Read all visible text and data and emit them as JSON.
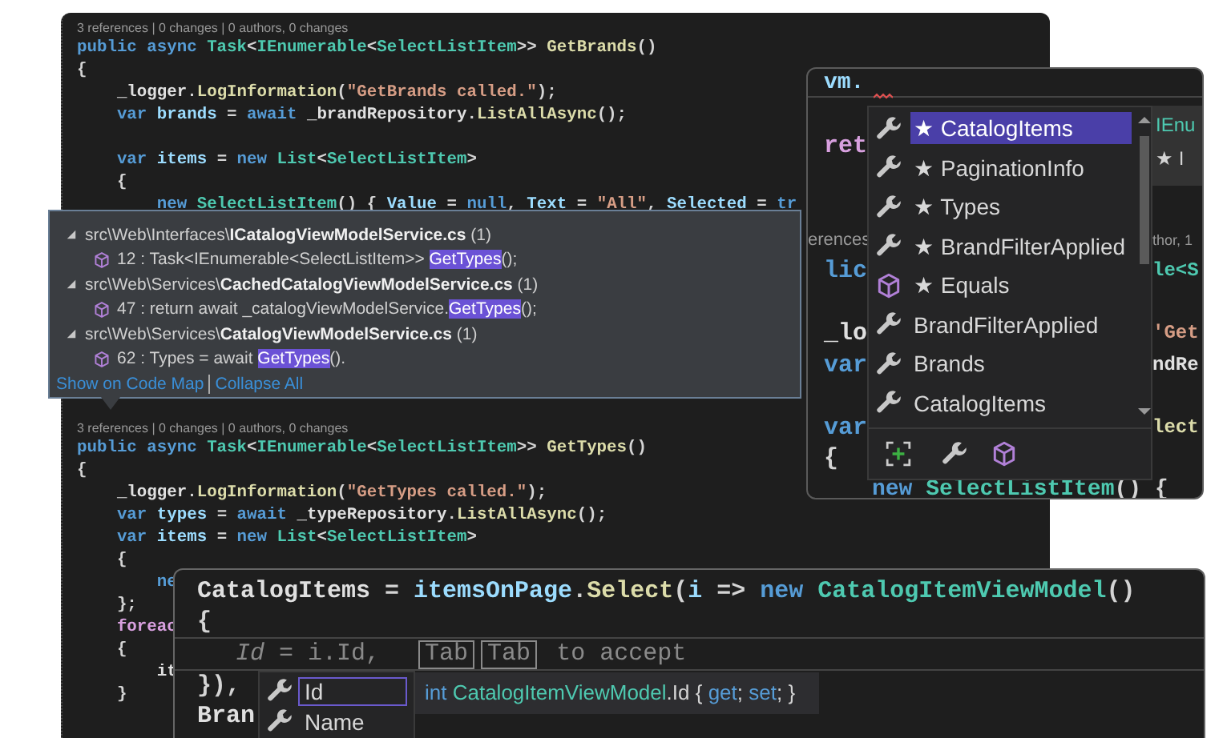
{
  "editor": {
    "lines_top": [
      {
        "kind": "lens",
        "text": "3 references | 0 changes | 0 authors, 0 changes"
      },
      {
        "kind": "code",
        "tokens": [
          {
            "text": "public async ",
            "kind": "kw"
          },
          {
            "text": "Task",
            "kind": "type"
          },
          {
            "text": "<",
            "kind": "plain"
          },
          {
            "text": "IEnumerable",
            "kind": "type"
          },
          {
            "text": "<",
            "kind": "plain"
          },
          {
            "text": "SelectListItem",
            "kind": "type"
          },
          {
            "text": ">> ",
            "kind": "plain"
          },
          {
            "text": "GetBrands",
            "kind": "method"
          },
          {
            "text": "()",
            "kind": "plain"
          }
        ]
      },
      {
        "kind": "code",
        "tokens": [
          {
            "text": "{",
            "kind": "plain"
          }
        ]
      },
      {
        "kind": "code",
        "tokens": [
          {
            "text": "    _logger",
            "kind": "field"
          },
          {
            "text": ".",
            "kind": "plain"
          },
          {
            "text": "LogInformation",
            "kind": "method"
          },
          {
            "text": "(",
            "kind": "plain"
          },
          {
            "text": "\"GetBrands called.\"",
            "kind": "str"
          },
          {
            "text": ");",
            "kind": "plain"
          }
        ]
      },
      {
        "kind": "code",
        "tokens": [
          {
            "text": "    var",
            "kind": "kw"
          },
          {
            "text": " brands",
            "kind": "var"
          },
          {
            "text": " = ",
            "kind": "plain"
          },
          {
            "text": "await",
            "kind": "kw"
          },
          {
            "text": " _brandRepository",
            "kind": "field"
          },
          {
            "text": ".",
            "kind": "plain"
          },
          {
            "text": "ListAllAsync",
            "kind": "method"
          },
          {
            "text": "();",
            "kind": "plain"
          }
        ]
      },
      {
        "kind": "blank"
      },
      {
        "kind": "code",
        "tokens": [
          {
            "text": "    var",
            "kind": "kw"
          },
          {
            "text": " items",
            "kind": "var"
          },
          {
            "text": " = ",
            "kind": "plain"
          },
          {
            "text": "new ",
            "kind": "kw"
          },
          {
            "text": "List",
            "kind": "type"
          },
          {
            "text": "<",
            "kind": "plain"
          },
          {
            "text": "SelectListItem",
            "kind": "type"
          },
          {
            "text": ">",
            "kind": "plain"
          }
        ]
      },
      {
        "kind": "code",
        "tokens": [
          {
            "text": "    {",
            "kind": "plain"
          }
        ]
      },
      {
        "kind": "code",
        "tokens": [
          {
            "text": "        new ",
            "kind": "kw"
          },
          {
            "text": "SelectListItem",
            "kind": "type"
          },
          {
            "text": "() { ",
            "kind": "plain"
          },
          {
            "text": "Value",
            "kind": "var"
          },
          {
            "text": " = ",
            "kind": "plain"
          },
          {
            "text": "null",
            "kind": "kw"
          },
          {
            "text": ", ",
            "kind": "plain"
          },
          {
            "text": "Text",
            "kind": "var"
          },
          {
            "text": " = ",
            "kind": "plain"
          },
          {
            "text": "\"All\"",
            "kind": "str"
          },
          {
            "text": ", ",
            "kind": "plain"
          },
          {
            "text": "Selected",
            "kind": "var"
          },
          {
            "text": " = ",
            "kind": "plain"
          },
          {
            "text": "tr",
            "kind": "kw"
          }
        ]
      }
    ],
    "lines_bottom": [
      {
        "kind": "lens",
        "text": "3 references | 0 changes | 0 authors, 0 changes"
      },
      {
        "kind": "code",
        "tokens": [
          {
            "text": "public async ",
            "kind": "kw"
          },
          {
            "text": "Task",
            "kind": "type"
          },
          {
            "text": "<",
            "kind": "plain"
          },
          {
            "text": "IEnumerable",
            "kind": "type"
          },
          {
            "text": "<",
            "kind": "plain"
          },
          {
            "text": "SelectListItem",
            "kind": "type"
          },
          {
            "text": ">> ",
            "kind": "plain"
          },
          {
            "text": "GetTypes",
            "kind": "method"
          },
          {
            "text": "()",
            "kind": "plain"
          }
        ]
      },
      {
        "kind": "code",
        "tokens": [
          {
            "text": "{",
            "kind": "plain"
          }
        ]
      },
      {
        "kind": "code",
        "tokens": [
          {
            "text": "    _logger",
            "kind": "field"
          },
          {
            "text": ".",
            "kind": "plain"
          },
          {
            "text": "LogInformation",
            "kind": "method"
          },
          {
            "text": "(",
            "kind": "plain"
          },
          {
            "text": "\"GetTypes called.\"",
            "kind": "str"
          },
          {
            "text": ");",
            "kind": "plain"
          }
        ]
      },
      {
        "kind": "code",
        "tokens": [
          {
            "text": "    var",
            "kind": "kw"
          },
          {
            "text": " types",
            "kind": "var"
          },
          {
            "text": " = ",
            "kind": "plain"
          },
          {
            "text": "await",
            "kind": "kw"
          },
          {
            "text": " _typeRepository",
            "kind": "field"
          },
          {
            "text": ".",
            "kind": "plain"
          },
          {
            "text": "ListAllAsync",
            "kind": "method"
          },
          {
            "text": "();",
            "kind": "plain"
          }
        ]
      },
      {
        "kind": "code",
        "tokens": [
          {
            "text": "    var",
            "kind": "kw"
          },
          {
            "text": " items",
            "kind": "var"
          },
          {
            "text": " = ",
            "kind": "plain"
          },
          {
            "text": "new ",
            "kind": "kw"
          },
          {
            "text": "List",
            "kind": "type"
          },
          {
            "text": "<",
            "kind": "plain"
          },
          {
            "text": "SelectListItem",
            "kind": "type"
          },
          {
            "text": ">",
            "kind": "plain"
          }
        ]
      },
      {
        "kind": "code",
        "tokens": [
          {
            "text": "    {",
            "kind": "plain"
          }
        ]
      },
      {
        "kind": "code",
        "tokens": [
          {
            "text": "        ne",
            "kind": "kw"
          }
        ]
      },
      {
        "kind": "code",
        "tokens": [
          {
            "text": "    };",
            "kind": "plain"
          }
        ]
      },
      {
        "kind": "code",
        "tokens": [
          {
            "text": "    foreac",
            "kind": "ctrl"
          }
        ]
      },
      {
        "kind": "code",
        "tokens": [
          {
            "text": "    {",
            "kind": "plain"
          }
        ]
      },
      {
        "kind": "code",
        "tokens": [
          {
            "text": "        it",
            "kind": "field"
          }
        ]
      },
      {
        "kind": "code",
        "tokens": [
          {
            "text": "    }",
            "kind": "plain"
          }
        ]
      }
    ]
  },
  "references": {
    "groups": [
      {
        "label": "src\\Web\\Interfaces\\**ICatalogViewModelService.cs** (1)",
        "expanded": true,
        "children": [
          {
            "text": "12 : Task<IEnumerable<SelectListItem>> ",
            "match": "GetTypes",
            "rest": "();"
          }
        ]
      },
      {
        "label": "src\\Web\\Services\\**CachedCatalogViewModelService.cs** (1)",
        "expanded": true,
        "children": [
          {
            "text": "47 : return await _catalogViewModelService.",
            "match": "GetTypes",
            "rest": "();"
          }
        ]
      },
      {
        "label": "src\\Web\\Services\\**CatalogViewModelService.cs** (1)",
        "expanded": true,
        "children": [
          {
            "text": "62 : Types = await ",
            "match": "GetTypes",
            "rest": "()."
          }
        ]
      }
    ],
    "links": [
      "Show on Code Map",
      "Collapse All"
    ]
  },
  "completion_window": {
    "input": "vm.",
    "rows": [
      {
        "kind": "code",
        "left": {
          "text": "ret",
          "kind": "ctrl"
        }
      },
      {
        "kind": "blank"
      },
      {
        "kind": "blank"
      },
      {
        "kind": "lens",
        "left": {
          "text": "erences",
          "kind": "lens"
        },
        "right": {
          "text": "thor, 1",
          "kind": "lens"
        }
      },
      {
        "kind": "code",
        "left": {
          "text": "lic",
          "kind": "kw"
        },
        "right": {
          "text": "le<S",
          "kind": "type"
        }
      },
      {
        "kind": "blank"
      },
      {
        "kind": "code",
        "left": {
          "text": "_lo",
          "kind": "field"
        },
        "right": {
          "text": "'Get",
          "kind": "str"
        }
      },
      {
        "kind": "code",
        "left": {
          "text": "var",
          "kind": "kw"
        },
        "right": {
          "text": "ndRe",
          "kind": "field"
        }
      },
      {
        "kind": "blank"
      },
      {
        "kind": "code",
        "left": {
          "text": "var",
          "kind": "kw"
        },
        "right": {
          "text": "lect",
          "kind": "method"
        }
      },
      {
        "kind": "code",
        "left": {
          "text": "{",
          "kind": "plain"
        }
      }
    ],
    "last_line": [
      {
        "text": "new",
        "kind": "kw"
      },
      {
        "text": " SelectListItem",
        "kind": "type"
      },
      {
        "text": "() {",
        "kind": "plain"
      }
    ],
    "detail": [
      {
        "text": "IEnu",
        "kind": "type"
      },
      {
        "text": "★ I",
        "kind": "plain"
      }
    ],
    "items": [
      {
        "label": "★ CatalogItems",
        "kind": "property",
        "selected": true
      },
      {
        "label": "★ PaginationInfo",
        "kind": "property",
        "selected": false
      },
      {
        "label": "★ Types",
        "kind": "property",
        "selected": false
      },
      {
        "label": "★ BrandFilterApplied",
        "kind": "property",
        "selected": false
      },
      {
        "label": "★ Equals",
        "kind": "method",
        "selected": false
      },
      {
        "label": "BrandFilterApplied",
        "kind": "property",
        "selected": false
      },
      {
        "label": "Brands",
        "kind": "property",
        "selected": false
      },
      {
        "label": "CatalogItems",
        "kind": "property",
        "selected": false
      }
    ]
  },
  "inline_panel": {
    "lines": [
      {
        "kind": "code",
        "tokens": [
          {
            "text": "CatalogItems",
            "kind": "field"
          },
          {
            "text": " = ",
            "kind": "plain"
          },
          {
            "text": "itemsOnPage",
            "kind": "var"
          },
          {
            "text": ".",
            "kind": "plain"
          },
          {
            "text": "Select",
            "kind": "method"
          },
          {
            "text": "(",
            "kind": "plain"
          },
          {
            "text": "i",
            "kind": "var"
          },
          {
            "text": " => ",
            "kind": "plain"
          },
          {
            "text": "new ",
            "kind": "kw"
          },
          {
            "text": "CatalogItemViewModel",
            "kind": "type"
          },
          {
            "text": "()",
            "kind": "plain"
          }
        ]
      },
      {
        "kind": "code",
        "tokens": [
          {
            "text": "{",
            "kind": "plain"
          }
        ]
      },
      {
        "kind": "ghost",
        "ghost": "*Id* = i.Id,",
        "keys": [
          "Tab",
          "Tab"
        ],
        "hint": "to accept"
      },
      {
        "kind": "code",
        "tokens": [
          {
            "text": "}),",
            "kind": "plain"
          }
        ]
      },
      {
        "kind": "code",
        "tokens": [
          {
            "text": "Bran",
            "kind": "field"
          }
        ]
      }
    ],
    "suggestions": [
      {
        "label": "Id",
        "selected": true
      },
      {
        "label": "Name",
        "selected": false
      }
    ],
    "tooltip": [
      {
        "text": "int ",
        "kind": "kw"
      },
      {
        "text": "CatalogItemViewModel",
        "kind": "type"
      },
      {
        "text": ".Id { ",
        "kind": "plain"
      },
      {
        "text": "get",
        "kind": "kw"
      },
      {
        "text": "; ",
        "kind": "plain"
      },
      {
        "text": "set",
        "kind": "kw"
      },
      {
        "text": "; }",
        "kind": "plain"
      }
    ]
  }
}
